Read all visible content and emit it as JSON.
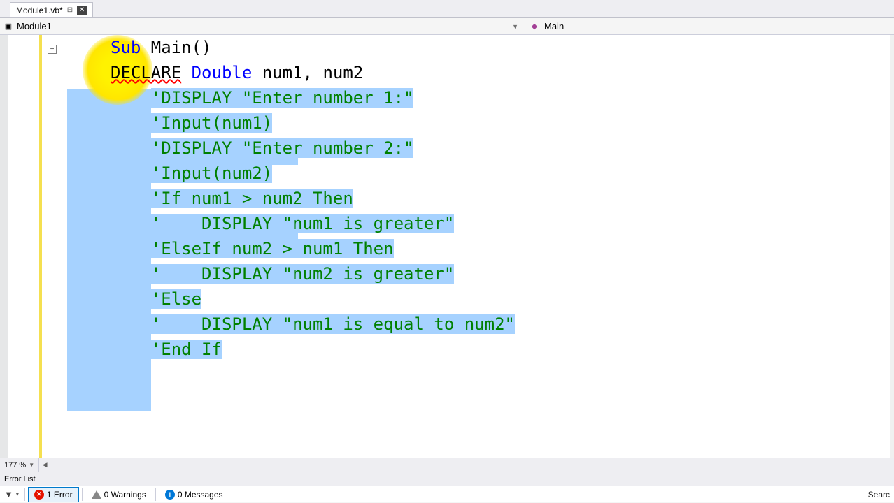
{
  "tab": {
    "title": "Module1.vb*",
    "pinned": true
  },
  "nav": {
    "scope": "Module1",
    "member": "Main"
  },
  "code": {
    "l1": {
      "a": "Sub",
      "b": " Main()"
    },
    "l2": {
      "a": "DECLARE",
      "b": " Double",
      "c": " num1, num2"
    },
    "l3": "'DISPLAY \"Enter number 1:\"",
    "l4": "'Input(num1)",
    "l5": "",
    "l6": "'DISPLAY \"Enter number 2:\"",
    "l7": "'Input(num2)",
    "l8": "",
    "l9": "'If num1 > num2 Then",
    "l10": "'    DISPLAY \"num1 is greater\"",
    "l11": "'ElseIf num2 > num1 Then",
    "l12": "'    DISPLAY \"num2 is greater\"",
    "l13": "'Else",
    "l14": "'    DISPLAY \"num1 is equal to num2\"",
    "l15": "'End If"
  },
  "zoom": "177 %",
  "errorlist": {
    "title": "Error List",
    "errors": "1 Error",
    "warnings": "0 Warnings",
    "messages": "0 Messages",
    "search": "Searc"
  }
}
